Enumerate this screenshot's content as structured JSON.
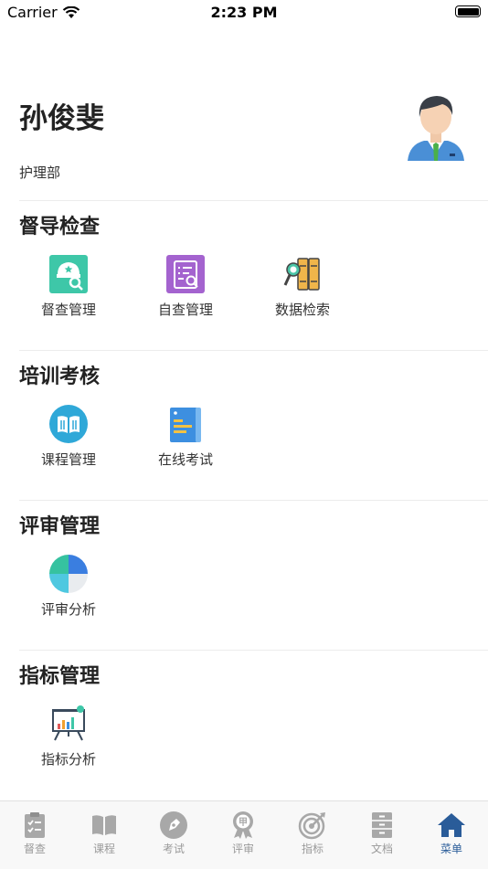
{
  "status": {
    "carrier": "Carrier",
    "time": "2:23 PM"
  },
  "profile": {
    "name": "孙俊斐",
    "department": "护理部"
  },
  "sections": {
    "supervision": {
      "title": "督导检查",
      "items": [
        {
          "label": "督查管理",
          "icon": "supervision-check-icon"
        },
        {
          "label": "自查管理",
          "icon": "self-check-icon"
        },
        {
          "label": "数据检索",
          "icon": "data-search-icon"
        }
      ]
    },
    "training": {
      "title": "培训考核",
      "items": [
        {
          "label": "课程管理",
          "icon": "course-book-icon"
        },
        {
          "label": "在线考试",
          "icon": "online-exam-icon"
        }
      ]
    },
    "review": {
      "title": "评审管理",
      "items": [
        {
          "label": "评审分析",
          "icon": "pie-chart-icon"
        }
      ]
    },
    "indicator": {
      "title": "指标管理",
      "items": [
        {
          "label": "指标分析",
          "icon": "presentation-chart-icon"
        }
      ]
    }
  },
  "tabbar": {
    "tabs": [
      {
        "label": "督查",
        "icon": "clipboard-icon",
        "active": false
      },
      {
        "label": "课程",
        "icon": "book-icon",
        "active": false
      },
      {
        "label": "考试",
        "icon": "pen-circle-icon",
        "active": false
      },
      {
        "label": "评审",
        "icon": "award-badge-icon",
        "active": false
      },
      {
        "label": "指标",
        "icon": "target-icon",
        "active": false
      },
      {
        "label": "文档",
        "icon": "file-cabinet-icon",
        "active": false
      },
      {
        "label": "菜单",
        "icon": "home-icon",
        "active": true
      }
    ]
  },
  "colors": {
    "accent": "#2a5c99",
    "inactive": "#9a9a9a"
  }
}
